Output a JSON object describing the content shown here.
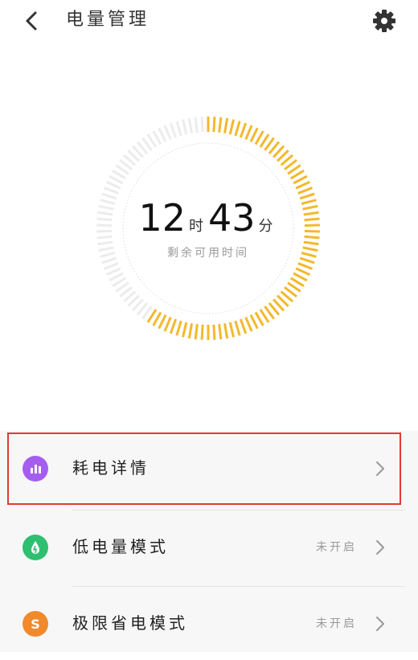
{
  "header": {
    "title": "电量管理",
    "back_icon": "chevron-left-icon",
    "settings_icon": "gear-icon"
  },
  "battery": {
    "hours": "12",
    "hours_unit": "时",
    "minutes": "43",
    "minutes_unit": "分",
    "label": "剩余可用时间",
    "level_fraction": 0.6,
    "colors": {
      "filled": "#f3b92c",
      "empty": "#ececec"
    }
  },
  "list": {
    "items": [
      {
        "label": "耗电详情",
        "status": "",
        "icon": "bar-chart-icon",
        "icon_color": "#a55df0"
      },
      {
        "label": "低电量模式",
        "status": "未开启",
        "icon": "leaf-drop-icon",
        "icon_color": "#2fbf71"
      },
      {
        "label": "极限省电模式",
        "status": "未开启",
        "icon": "s-letter-icon",
        "icon_glyph": "S",
        "icon_color": "#f08a2c"
      }
    ]
  }
}
